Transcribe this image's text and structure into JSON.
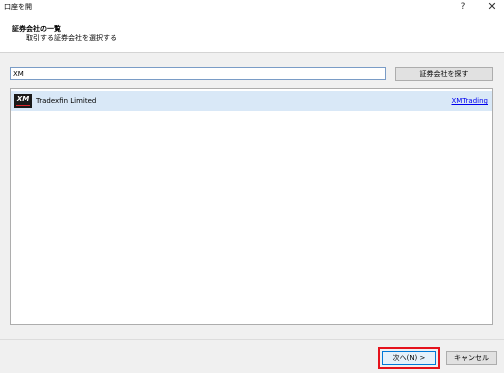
{
  "window": {
    "title": "口座を開",
    "help_label": "?",
    "close_label": "✕"
  },
  "header": {
    "title": "証券会社の一覧",
    "subtitle": "取引する証券会社を選択する"
  },
  "search": {
    "value": "XM",
    "button_label": "証券会社を探す"
  },
  "results": [
    {
      "logo_text": "XM",
      "name": "Tradexfin Limited",
      "link": "XMTrading"
    }
  ],
  "footer": {
    "next_label": "次へ(N) >",
    "cancel_label": "キャンセル"
  },
  "colors": {
    "selected_row": "#d9e8f7",
    "highlight_border": "#e5121c",
    "link": "#0000ee"
  }
}
